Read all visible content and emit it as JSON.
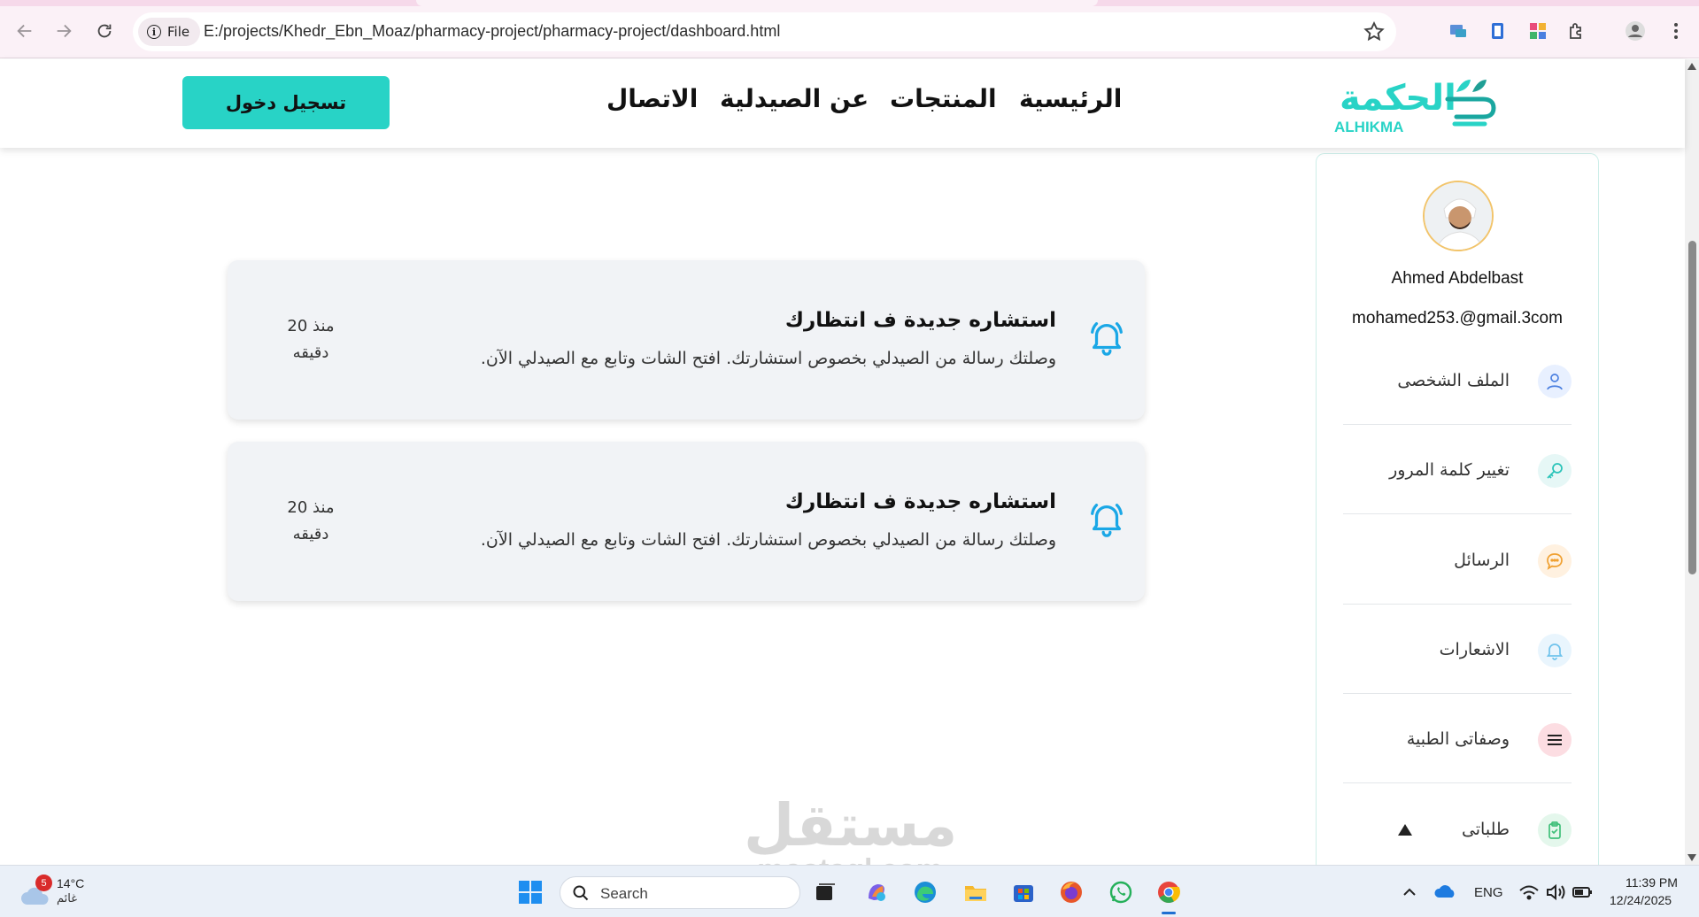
{
  "browser": {
    "chip_label": "File",
    "url": "E:/projects/Khedr_Ebn_Moaz/pharmacy-project/pharmacy-project/dashboard.html"
  },
  "header": {
    "login_label": "تسجيل دخول",
    "nav": {
      "home": "الرئيسية",
      "products": "المنتجات",
      "about": "عن الصيدلية",
      "contact": "الاتصال"
    },
    "logo": {
      "arabic": "الحكمة",
      "latin": "ALHIKMA",
      "brand_color": "#28d3c6"
    }
  },
  "notifications": [
    {
      "title": "استشاره جديدة ف انتظارك",
      "body": "وصلتك رسالة من الصيدلي بخصوص استشارتك. افتح الشات وتابع مع الصيدلي الآن.",
      "time_line1": "منذ 20",
      "time_line2": "دقيقه"
    },
    {
      "title": "استشاره جديدة ف انتظارك",
      "body": "وصلتك رسالة من الصيدلي بخصوص استشارتك. افتح الشات وتابع مع الصيدلي الآن.",
      "time_line1": "منذ 20",
      "time_line2": "دقيقه"
    }
  ],
  "sidebar": {
    "user_name": "Ahmed Abdelbast",
    "user_email": "mohamed253.@gmail.3com",
    "items": [
      {
        "label": "الملف الشخصى",
        "icon": "user-icon"
      },
      {
        "label": "تغيير كلمة المرور",
        "icon": "key-icon"
      },
      {
        "label": "الرسائل",
        "icon": "chat-icon"
      },
      {
        "label": "الاشعارات",
        "icon": "bell-icon"
      },
      {
        "label": "وصفاتى الطبية",
        "icon": "menu-icon"
      },
      {
        "label": "طلباتى",
        "icon": "clipboard-icon"
      }
    ]
  },
  "watermark": {
    "arabic": "مستقل",
    "latin": "mostaql.com"
  },
  "taskbar": {
    "weather_badge": "5",
    "weather_temp": "14°C",
    "weather_cond": "غائم",
    "search_label": "Search",
    "lang": "ENG",
    "time": "11:39 PM",
    "date": "12/24/2025"
  }
}
